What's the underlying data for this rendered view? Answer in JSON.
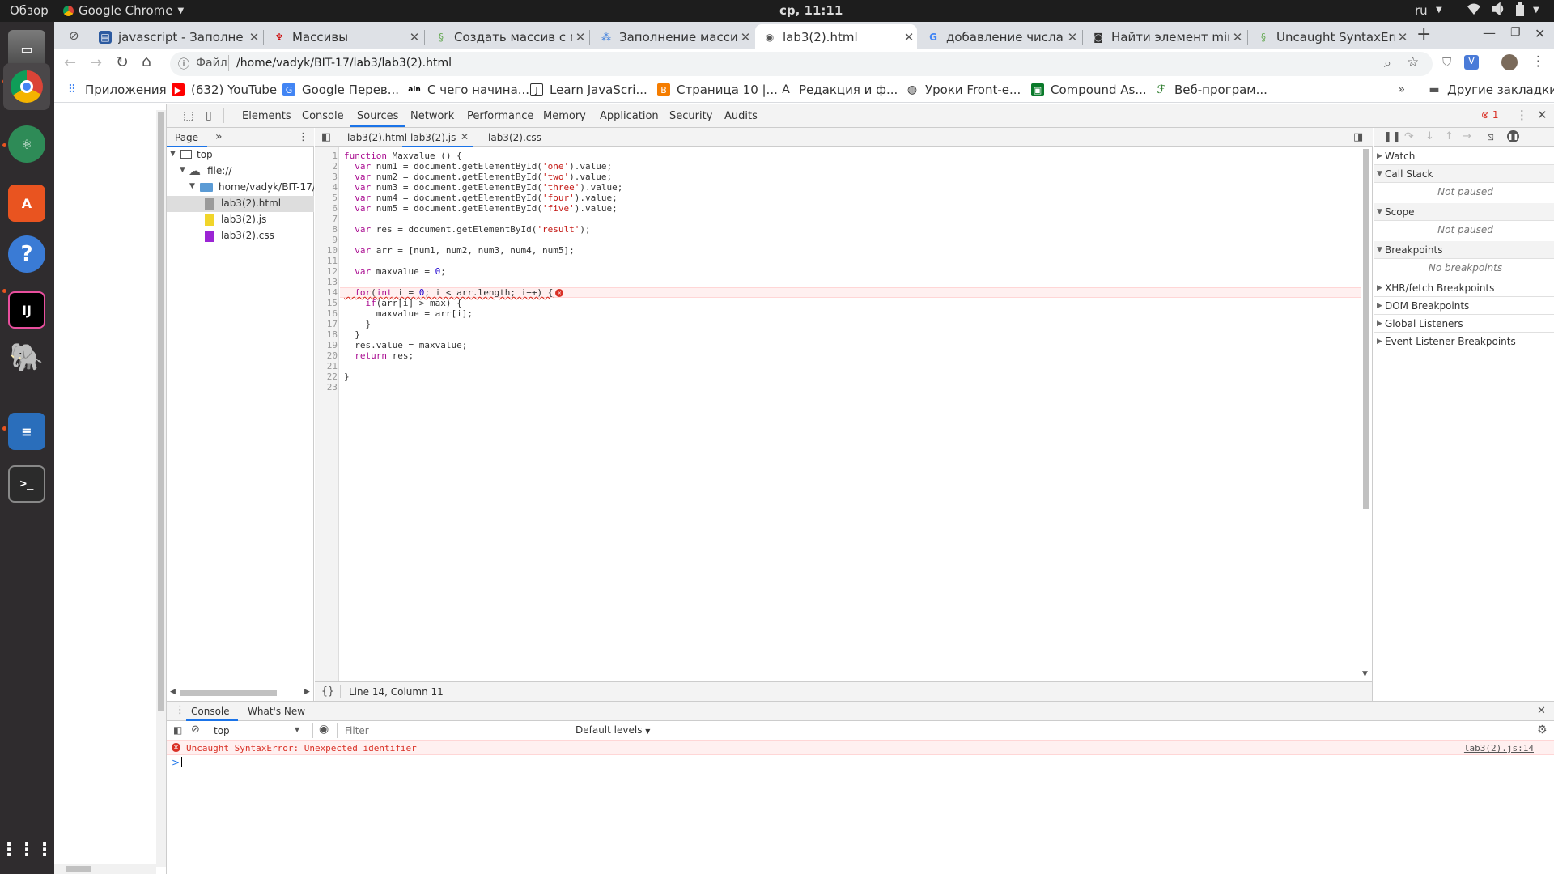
{
  "system_bar": {
    "activities": "Обзор",
    "app_name": "Google Chrome",
    "clock": "ср, 11:11",
    "language": "ru"
  },
  "colors": {
    "accent": "#1a73e8",
    "error": "#d93025",
    "dock_bg": "#2f2c2e",
    "topbar_bg": "#1d1d1d",
    "tabstrip_bg": "#dee1e6"
  },
  "tabs": [
    {
      "title": "javascript - Заполне",
      "icon": "stackoverflow-icon"
    },
    {
      "title": "Массивы",
      "icon": "javascript-ru-icon"
    },
    {
      "title": "Создать массив с по",
      "icon": "cyberforum-icon"
    },
    {
      "title": "Заполнение масси",
      "icon": "site-icon"
    },
    {
      "title": "lab3(2).html",
      "icon": "globe-icon",
      "active": true
    },
    {
      "title": "добавление числа",
      "icon": "google-icon"
    },
    {
      "title": "Найти элемент min",
      "icon": "glasses-icon"
    },
    {
      "title": "Uncaught SyntaxErr",
      "icon": "cyberforum-icon"
    }
  ],
  "address_bar": {
    "scheme_label": "Файл",
    "url": "/home/vadyk/BIT-17/lab3/lab3(2).html"
  },
  "bookmarks": [
    {
      "label": "Приложения",
      "icon": "apps-grid-icon"
    },
    {
      "label": "(632) YouTube",
      "icon": "youtube-icon"
    },
    {
      "label": "Google Перев...",
      "icon": "translate-icon"
    },
    {
      "label": "С чего начина...",
      "icon": "ain-icon"
    },
    {
      "label": "Learn JavaScri...",
      "icon": "doc-icon"
    },
    {
      "label": "Страница 10 |...",
      "icon": "blogger-icon"
    },
    {
      "label": "Редакция и ф...",
      "icon": "font-icon"
    },
    {
      "label": "Уроки Front-e...",
      "icon": "globe-icon"
    },
    {
      "label": "Compound As...",
      "icon": "green-icon"
    },
    {
      "label": "Веб-програм...",
      "icon": "bookmark-icon"
    }
  ],
  "other_bookmarks": "Другие закладки",
  "devtools": {
    "tabs": [
      "Elements",
      "Console",
      "Sources",
      "Network",
      "Performance",
      "Memory",
      "Application",
      "Security",
      "Audits"
    ],
    "active_tab": "Sources",
    "error_count": "1",
    "navigator": {
      "tab_label": "Page",
      "tree": [
        {
          "label": "top",
          "level": 0
        },
        {
          "label": "file://",
          "level": 1
        },
        {
          "label": "home/vadyk/BIT-17/",
          "level": 2
        },
        {
          "label": "lab3(2).html",
          "level": 3
        },
        {
          "label": "lab3(2).js",
          "level": 3
        },
        {
          "label": "lab3(2).css",
          "level": 3
        }
      ]
    },
    "editor_tabs": [
      "lab3(2).html",
      "lab3(2).js",
      "lab3(2).css"
    ],
    "code_lines": [
      "function Maxvalue () {",
      "  var num1 = document.getElementById('one').value;",
      "  var num2 = document.getElementById('two').value;",
      "  var num3 = document.getElementById('three').value;",
      "  var num4 = document.getElementById('four').value;",
      "  var num5 = document.getElementById('five').value;",
      "",
      "  var res = document.getElementById('result');",
      "",
      "  var arr = [num1, num2, num3, num4, num5];",
      "",
      "  var maxvalue = 0;",
      "",
      "  for(int i = 0; i < arr.length; i++) {",
      "    if(arr[i] > max) {",
      "      maxvalue = arr[i];",
      "    }",
      "  }",
      "  res.value = maxvalue;",
      "  return res;",
      "",
      "}",
      ""
    ],
    "error_line": 14,
    "status": "Line 14, Column 11",
    "debugger": {
      "watch": "Watch",
      "call_stack": "Call Stack",
      "not_paused": "Not paused",
      "scope": "Scope",
      "breakpoints": "Breakpoints",
      "no_breakpoints": "No breakpoints",
      "xhr": "XHR/fetch Breakpoints",
      "dom": "DOM Breakpoints",
      "global": "Global Listeners",
      "event": "Event Listener Breakpoints"
    },
    "drawer": {
      "tabs": [
        "Console",
        "What's New"
      ],
      "context": "top",
      "filter_placeholder": "Filter",
      "levels": "Default levels",
      "error_message": "Uncaught SyntaxError: Unexpected identifier",
      "error_source": "lab3(2).js:14",
      "prompt": ">"
    }
  }
}
